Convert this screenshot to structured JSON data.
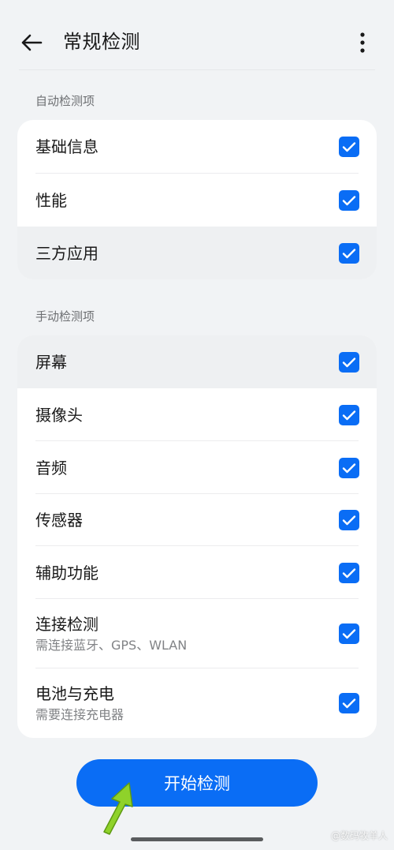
{
  "header": {
    "title": "常规检测"
  },
  "auto_section": {
    "label": "自动检测项",
    "items": [
      {
        "label": "基础信息",
        "checked": true
      },
      {
        "label": "性能",
        "checked": true
      },
      {
        "label": "三方应用",
        "checked": true
      }
    ]
  },
  "manual_section": {
    "label": "手动检测项",
    "items": [
      {
        "label": "屏幕",
        "checked": true
      },
      {
        "label": "摄像头",
        "checked": true
      },
      {
        "label": "音频",
        "checked": true
      },
      {
        "label": "传感器",
        "checked": true
      },
      {
        "label": "辅助功能",
        "checked": true
      },
      {
        "label": "连接检测",
        "sub": "需连接蓝牙、GPS、WLAN",
        "checked": true
      },
      {
        "label": "电池与充电",
        "sub": "需要连接充电器",
        "checked": true
      }
    ]
  },
  "start_button": {
    "label": "开始检测"
  },
  "watermark": {
    "text": "@数码牧羊人"
  },
  "colors": {
    "accent": "#0a6df5",
    "background": "#f1f3f5",
    "card": "#ffffff",
    "arrow": "#8fd22a"
  },
  "icons": {
    "back": "arrow-left-icon",
    "more": "more-vertical-icon",
    "check": "check-icon"
  }
}
